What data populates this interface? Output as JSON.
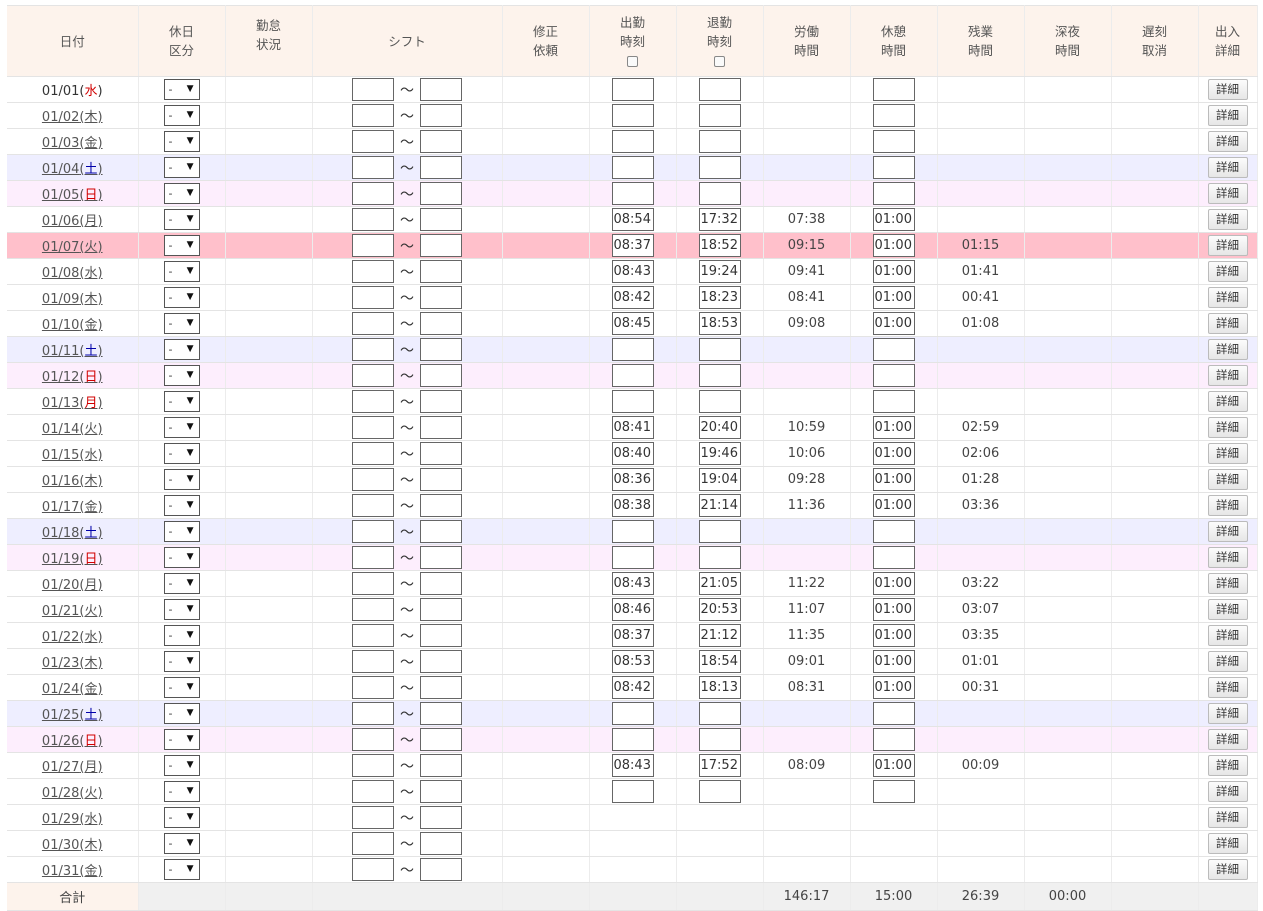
{
  "headers": {
    "date": "日付",
    "holiday_line1": "休日",
    "holiday_line2": "区分",
    "status_line1": "勤怠",
    "status_line2": "状況",
    "shift": "シフト",
    "correction_line1": "修正",
    "correction_line2": "依頼",
    "clock_in_line1": "出勤",
    "clock_in_line2": "時刻",
    "clock_out_line1": "退勤",
    "clock_out_line2": "時刻",
    "work_line1": "労働",
    "work_line2": "時間",
    "break_line1": "休憩",
    "break_line2": "時間",
    "overtime_line1": "残業",
    "overtime_line2": "時間",
    "night_line1": "深夜",
    "night_line2": "時間",
    "late_line1": "遅刻",
    "late_line2": "取消",
    "detail_line1": "出入",
    "detail_line2": "詳細"
  },
  "labels": {
    "select_default": "-",
    "tilde": "～",
    "detail_button": "詳細"
  },
  "rows": [
    {
      "md": "01/01",
      "wd": "水",
      "wd_color": "red",
      "type": "weekday",
      "link": false,
      "in": "",
      "out": "",
      "work": "",
      "brk": "",
      "ot": "",
      "editable": true
    },
    {
      "md": "01/02",
      "wd": "木",
      "wd_color": "",
      "type": "weekday",
      "link": true,
      "in": "",
      "out": "",
      "work": "",
      "brk": "",
      "ot": "",
      "editable": true
    },
    {
      "md": "01/03",
      "wd": "金",
      "wd_color": "",
      "type": "weekday",
      "link": true,
      "in": "",
      "out": "",
      "work": "",
      "brk": "",
      "ot": "",
      "editable": true
    },
    {
      "md": "01/04",
      "wd": "土",
      "wd_color": "blue",
      "type": "sat",
      "link": true,
      "in": "",
      "out": "",
      "work": "",
      "brk": "",
      "ot": "",
      "editable": true
    },
    {
      "md": "01/05",
      "wd": "日",
      "wd_color": "red",
      "type": "sun",
      "link": true,
      "in": "",
      "out": "",
      "work": "",
      "brk": "",
      "ot": "",
      "editable": true
    },
    {
      "md": "01/06",
      "wd": "月",
      "wd_color": "",
      "type": "weekday",
      "link": true,
      "in": "08:54",
      "out": "17:32",
      "work": "07:38",
      "brk": "01:00",
      "ot": "",
      "editable": true
    },
    {
      "md": "01/07",
      "wd": "火",
      "wd_color": "",
      "type": "hl",
      "link": true,
      "in": "08:37",
      "out": "18:52",
      "work": "09:15",
      "brk": "01:00",
      "ot": "01:15",
      "editable": true
    },
    {
      "md": "01/08",
      "wd": "水",
      "wd_color": "",
      "type": "weekday",
      "link": true,
      "in": "08:43",
      "out": "19:24",
      "work": "09:41",
      "brk": "01:00",
      "ot": "01:41",
      "editable": true
    },
    {
      "md": "01/09",
      "wd": "木",
      "wd_color": "",
      "type": "weekday",
      "link": true,
      "in": "08:42",
      "out": "18:23",
      "work": "08:41",
      "brk": "01:00",
      "ot": "00:41",
      "editable": true
    },
    {
      "md": "01/10",
      "wd": "金",
      "wd_color": "",
      "type": "weekday",
      "link": true,
      "in": "08:45",
      "out": "18:53",
      "work": "09:08",
      "brk": "01:00",
      "ot": "01:08",
      "editable": true
    },
    {
      "md": "01/11",
      "wd": "土",
      "wd_color": "blue",
      "type": "sat",
      "link": true,
      "in": "",
      "out": "",
      "work": "",
      "brk": "",
      "ot": "",
      "editable": true
    },
    {
      "md": "01/12",
      "wd": "日",
      "wd_color": "red",
      "type": "sun",
      "link": true,
      "in": "",
      "out": "",
      "work": "",
      "brk": "",
      "ot": "",
      "editable": true
    },
    {
      "md": "01/13",
      "wd": "月",
      "wd_color": "red",
      "type": "weekday",
      "link": true,
      "in": "",
      "out": "",
      "work": "",
      "brk": "",
      "ot": "",
      "editable": true
    },
    {
      "md": "01/14",
      "wd": "火",
      "wd_color": "",
      "type": "weekday",
      "link": true,
      "in": "08:41",
      "out": "20:40",
      "work": "10:59",
      "brk": "01:00",
      "ot": "02:59",
      "editable": true
    },
    {
      "md": "01/15",
      "wd": "水",
      "wd_color": "",
      "type": "weekday",
      "link": true,
      "in": "08:40",
      "out": "19:46",
      "work": "10:06",
      "brk": "01:00",
      "ot": "02:06",
      "editable": true
    },
    {
      "md": "01/16",
      "wd": "木",
      "wd_color": "",
      "type": "weekday",
      "link": true,
      "in": "08:36",
      "out": "19:04",
      "work": "09:28",
      "brk": "01:00",
      "ot": "01:28",
      "editable": true
    },
    {
      "md": "01/17",
      "wd": "金",
      "wd_color": "",
      "type": "weekday",
      "link": true,
      "in": "08:38",
      "out": "21:14",
      "work": "11:36",
      "brk": "01:00",
      "ot": "03:36",
      "editable": true
    },
    {
      "md": "01/18",
      "wd": "土",
      "wd_color": "blue",
      "type": "sat",
      "link": true,
      "in": "",
      "out": "",
      "work": "",
      "brk": "",
      "ot": "",
      "editable": true
    },
    {
      "md": "01/19",
      "wd": "日",
      "wd_color": "red",
      "type": "sun",
      "link": true,
      "in": "",
      "out": "",
      "work": "",
      "brk": "",
      "ot": "",
      "editable": true
    },
    {
      "md": "01/20",
      "wd": "月",
      "wd_color": "",
      "type": "weekday",
      "link": true,
      "in": "08:43",
      "out": "21:05",
      "work": "11:22",
      "brk": "01:00",
      "ot": "03:22",
      "editable": true
    },
    {
      "md": "01/21",
      "wd": "火",
      "wd_color": "",
      "type": "weekday",
      "link": true,
      "in": "08:46",
      "out": "20:53",
      "work": "11:07",
      "brk": "01:00",
      "ot": "03:07",
      "editable": true
    },
    {
      "md": "01/22",
      "wd": "水",
      "wd_color": "",
      "type": "weekday",
      "link": true,
      "in": "08:37",
      "out": "21:12",
      "work": "11:35",
      "brk": "01:00",
      "ot": "03:35",
      "editable": true
    },
    {
      "md": "01/23",
      "wd": "木",
      "wd_color": "",
      "type": "weekday",
      "link": true,
      "in": "08:53",
      "out": "18:54",
      "work": "09:01",
      "brk": "01:00",
      "ot": "01:01",
      "editable": true
    },
    {
      "md": "01/24",
      "wd": "金",
      "wd_color": "",
      "type": "weekday",
      "link": true,
      "in": "08:42",
      "out": "18:13",
      "work": "08:31",
      "brk": "01:00",
      "ot": "00:31",
      "editable": true
    },
    {
      "md": "01/25",
      "wd": "土",
      "wd_color": "blue",
      "type": "sat",
      "link": true,
      "in": "",
      "out": "",
      "work": "",
      "brk": "",
      "ot": "",
      "editable": true
    },
    {
      "md": "01/26",
      "wd": "日",
      "wd_color": "red",
      "type": "sun",
      "link": true,
      "in": "",
      "out": "",
      "work": "",
      "brk": "",
      "ot": "",
      "editable": true
    },
    {
      "md": "01/27",
      "wd": "月",
      "wd_color": "",
      "type": "weekday",
      "link": true,
      "in": "08:43",
      "out": "17:52",
      "work": "08:09",
      "brk": "01:00",
      "ot": "00:09",
      "editable": true
    },
    {
      "md": "01/28",
      "wd": "火",
      "wd_color": "",
      "type": "weekday",
      "link": true,
      "in": "",
      "out": "",
      "work": "",
      "brk": "",
      "ot": "",
      "editable": true
    },
    {
      "md": "01/29",
      "wd": "水",
      "wd_color": "",
      "type": "weekday",
      "link": true,
      "in": "",
      "out": "",
      "work": "",
      "brk": "",
      "ot": "",
      "editable": false
    },
    {
      "md": "01/30",
      "wd": "木",
      "wd_color": "",
      "type": "weekday",
      "link": true,
      "in": "",
      "out": "",
      "work": "",
      "brk": "",
      "ot": "",
      "editable": false
    },
    {
      "md": "01/31",
      "wd": "金",
      "wd_color": "",
      "type": "weekday",
      "link": true,
      "in": "",
      "out": "",
      "work": "",
      "brk": "",
      "ot": "",
      "editable": false
    }
  ],
  "totals": {
    "label": "合計",
    "work": "146:17",
    "break": "15:00",
    "overtime": "26:39",
    "night": "00:00"
  }
}
